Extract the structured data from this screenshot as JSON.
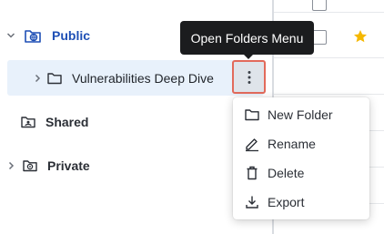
{
  "tooltip": {
    "text": "Open Folders Menu"
  },
  "tree": {
    "public": {
      "label": "Public"
    },
    "child": {
      "label": "Vulnerabilities Deep Dive"
    },
    "shared": {
      "label": "Shared"
    },
    "private": {
      "label": "Private"
    }
  },
  "menu": {
    "items": [
      {
        "label": "New Folder",
        "icon": "folder-icon"
      },
      {
        "label": "Rename",
        "icon": "pencil-icon"
      },
      {
        "label": "Delete",
        "icon": "trash-icon"
      },
      {
        "label": "Export",
        "icon": "download-icon"
      }
    ]
  },
  "colors": {
    "accent": "#1e4fb5",
    "selected_bg": "#e8f1fb",
    "focus_outline": "#e26a5b",
    "tooltip_bg": "#1b1c1e",
    "star": "#f5b800"
  }
}
